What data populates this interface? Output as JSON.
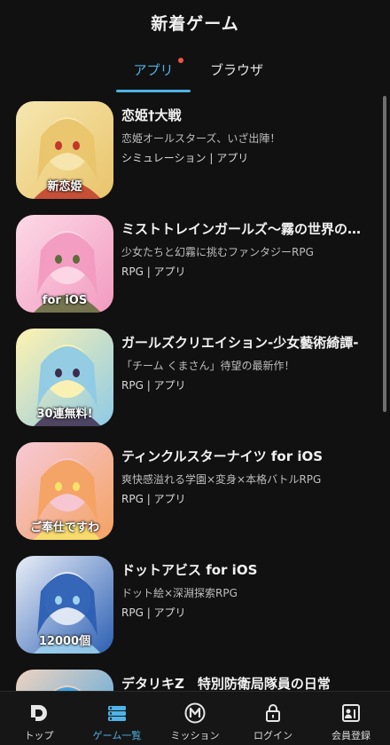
{
  "header": {
    "title": "新着ゲーム"
  },
  "tabs": [
    {
      "label": "アプリ",
      "active": true,
      "has_badge": true
    },
    {
      "label": "ブラウザ",
      "active": false,
      "has_badge": false
    }
  ],
  "games": [
    {
      "title": "恋姫†大戦",
      "description": "恋姫オールスターズ、いざ出陣！",
      "meta": "シミュレーション | アプリ",
      "thumb_text": "新恋姫",
      "thumb_colors": [
        "#e9c46a",
        "#c0392b",
        "#f6e7b0"
      ]
    },
    {
      "title": "ミストトレインガールズ〜霧の世界の車窓から〜",
      "description": "少女たちと幻霧に挑むファンタジーRPG",
      "meta": "RPG | アプリ",
      "thumb_text": "for iOS",
      "thumb_colors": [
        "#f29ac0",
        "#5e6b3a",
        "#fcd9e6"
      ]
    },
    {
      "title": "ガールズクリエイション-少女藝術綺譚-",
      "description": "「チーム くまさん」待望の最新作！",
      "meta": "RPG | アプリ",
      "thumb_text": "30連無料!",
      "thumb_colors": [
        "#8ecae6",
        "#3d2c4e",
        "#fff3b0"
      ]
    },
    {
      "title": "ティンクルスターナイツ for iOS",
      "description": "爽快感溢れる学園×変身×本格バトルRPG",
      "meta": "RPG | アプリ",
      "thumb_text": "ご奉仕ですわ",
      "thumb_colors": [
        "#f4a261",
        "#f7e36a",
        "#f6c9d8"
      ]
    },
    {
      "title": "ドットアビス for iOS",
      "description": "ドット絵×深淵探索RPG",
      "meta": "RPG | アプリ",
      "thumb_text": "12000個",
      "thumb_colors": [
        "#2b5fb3",
        "#9fd3f0",
        "#e9eef7"
      ]
    },
    {
      "title": "デタリキZ　特別防衛局隊員の日常",
      "description": "",
      "meta": "",
      "thumb_text": "",
      "thumb_colors": [
        "#3aa0e0",
        "#2a2a3a",
        "#f0d3c0"
      ]
    }
  ],
  "bottom_nav": [
    {
      "label": "トップ",
      "icon": "top-icon",
      "active": false
    },
    {
      "label": "ゲーム一覧",
      "icon": "list-icon",
      "active": true
    },
    {
      "label": "ミッション",
      "icon": "mission-icon",
      "active": false
    },
    {
      "label": "ログイン",
      "icon": "lock-icon",
      "active": false
    },
    {
      "label": "会員登録",
      "icon": "member-card-icon",
      "active": false
    }
  ],
  "colors": {
    "accent": "#4fb3e6",
    "background": "#111111",
    "badge": "#f0544a"
  }
}
